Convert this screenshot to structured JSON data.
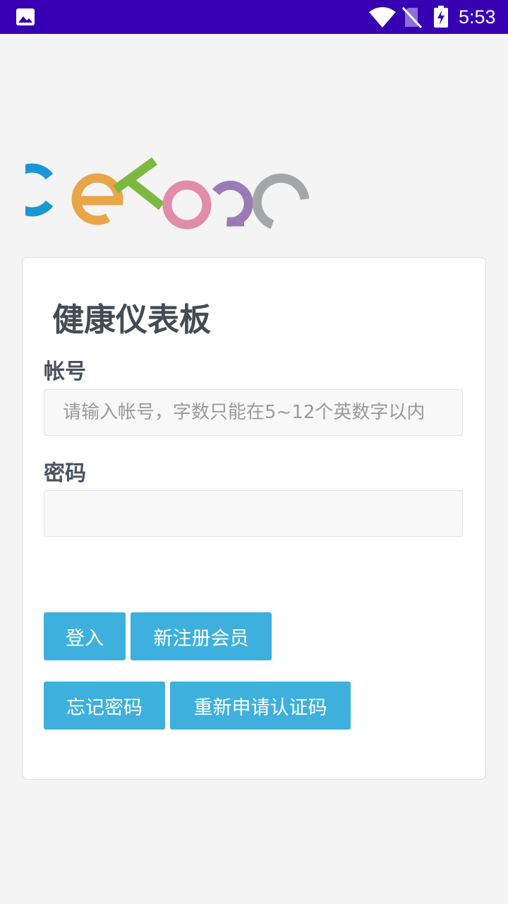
{
  "status_bar": {
    "time": "5:53",
    "icons": [
      "gallery-icon",
      "wifi-icon",
      "no-sim-icon",
      "battery-charging-icon"
    ]
  },
  "logo": {
    "text": "CETOSC",
    "colors": [
      "#1a96d4",
      "#e9a549",
      "#7bb941",
      "#e08da9",
      "#9b7bb5",
      "#a4a6a8"
    ]
  },
  "form": {
    "title": "健康仪表板",
    "account_label": "帐号",
    "account_placeholder": "请输入帐号，字数只能在5~12个英数字以内",
    "account_value": "",
    "password_label": "密码",
    "password_value": ""
  },
  "buttons": {
    "login": "登入",
    "register": "新注册会员",
    "forgot_password": "忘记密码",
    "resend_code": "重新申请认证码"
  },
  "colors": {
    "status_bar": "#3700b3",
    "button": "#3eb0dd",
    "background": "#f4f4f4"
  }
}
